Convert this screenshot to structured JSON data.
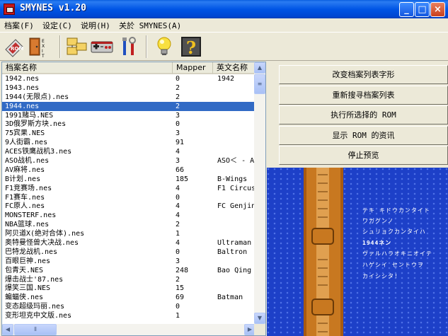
{
  "window": {
    "title": "SMYNES v1.20",
    "buttons": {
      "minimize": "_",
      "maximize": "□",
      "close": "×"
    }
  },
  "menu": [
    "档案(F)",
    "设定(C)",
    "说明(H)",
    "关於 SMYNES(A)"
  ],
  "toolbar": {
    "icons": [
      "rom-icon",
      "exit-icon",
      "folders-icon",
      "gamepad-icon",
      "tools-icon",
      "lightbulb-icon",
      "help-icon"
    ]
  },
  "list": {
    "columns": [
      "档案名称",
      "Mapper",
      "英文名称"
    ],
    "selected_index": 3,
    "rows": [
      {
        "file": "1942.nes",
        "mapper": "0",
        "english": "1942"
      },
      {
        "file": "1943.nes",
        "mapper": "2",
        "english": ""
      },
      {
        "file": "1944(无限点).nes",
        "mapper": "2",
        "english": ""
      },
      {
        "file": "1944.nes",
        "mapper": "2",
        "english": ""
      },
      {
        "file": "1991赌马.NES",
        "mapper": "3",
        "english": ""
      },
      {
        "file": "3D俄罗斯方块.nes",
        "mapper": "0",
        "english": ""
      },
      {
        "file": "75宾果.NES",
        "mapper": "3",
        "english": ""
      },
      {
        "file": "9人街霸.nes",
        "mapper": "91",
        "english": ""
      },
      {
        "file": "ACES铁鹰战机3.nes",
        "mapper": "4",
        "english": ""
      },
      {
        "file": "ASO战机.nes",
        "mapper": "3",
        "english": "ASO＜ - Ar"
      },
      {
        "file": "AV麻将.nes",
        "mapper": "66",
        "english": ""
      },
      {
        "file": "B计划.nes",
        "mapper": "185",
        "english": "B-Wings"
      },
      {
        "file": "F1竞赛场.nes",
        "mapper": "4",
        "english": "F1 Circus"
      },
      {
        "file": "F1赛车.nes",
        "mapper": "0",
        "english": ""
      },
      {
        "file": "FC原人.nes",
        "mapper": "4",
        "english": "FC Genjin"
      },
      {
        "file": "MONSTERF.nes",
        "mapper": "4",
        "english": ""
      },
      {
        "file": "NBA篮球.nes",
        "mapper": "2",
        "english": ""
      },
      {
        "file": "阿贝道X(绝对合体).nes",
        "mapper": "1",
        "english": ""
      },
      {
        "file": "奥特曼怪兽大决战.nes",
        "mapper": "4",
        "english": "Ultraman"
      },
      {
        "file": "巴特龙战机.nes",
        "mapper": "0",
        "english": "Baltron"
      },
      {
        "file": "百眼巨神.nes",
        "mapper": "3",
        "english": ""
      },
      {
        "file": "包青天.NES",
        "mapper": "248",
        "english": "Bao Qing"
      },
      {
        "file": "爆击战士'87.nes",
        "mapper": "2",
        "english": ""
      },
      {
        "file": "爆笑三国.NES",
        "mapper": "15",
        "english": ""
      },
      {
        "file": "蝙蝠侠.nes",
        "mapper": "69",
        "english": "Batman"
      },
      {
        "file": "变态超级玛丽.nes",
        "mapper": "0",
        "english": ""
      },
      {
        "file": "变形坦克中文版.nes",
        "mapper": "1",
        "english": ""
      }
    ]
  },
  "actions": [
    "改变档案列表字形",
    "重新搜寻档案列表",
    "执行所选择的 ROM",
    "显示 ROM 的资讯",
    "停止预览"
  ],
  "preview": {
    "text_lines": [
      "テキ キドウカンタイト",
      "ワガグンノ",
      "シュリョクカンタイハ",
      "1944ネン",
      "ヴァルハラオキニオイテ",
      "ハゲシイ セントウヲ",
      "カイシシタ!"
    ]
  }
}
